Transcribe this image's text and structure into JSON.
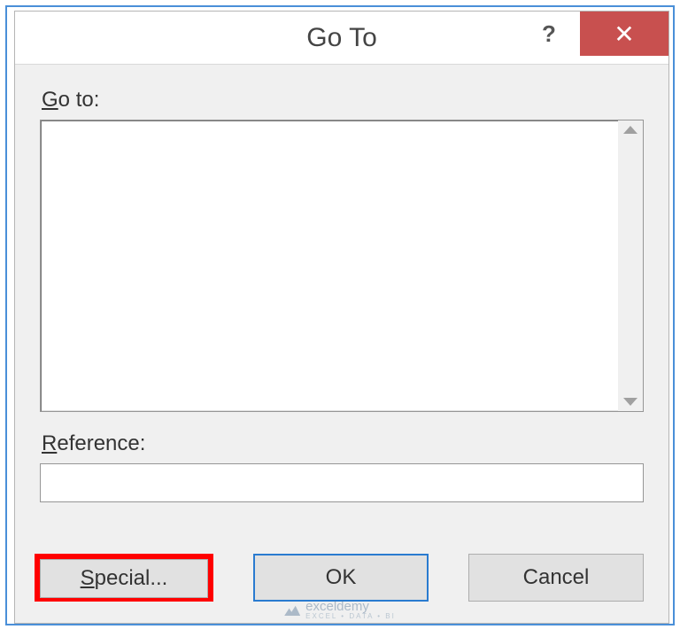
{
  "titlebar": {
    "title": "Go To",
    "help_label": "?",
    "close_label": "✕"
  },
  "labels": {
    "goto_prefix": "G",
    "goto_rest": "o to:",
    "reference_prefix": "R",
    "reference_rest": "eference:"
  },
  "listbox": {
    "items": []
  },
  "reference": {
    "value": "",
    "placeholder": ""
  },
  "buttons": {
    "special_prefix": "S",
    "special_rest": "pecial...",
    "ok": "OK",
    "cancel": "Cancel"
  },
  "watermark": {
    "brand": "exceldemy",
    "tagline": "EXCEL • DATA • BI"
  }
}
